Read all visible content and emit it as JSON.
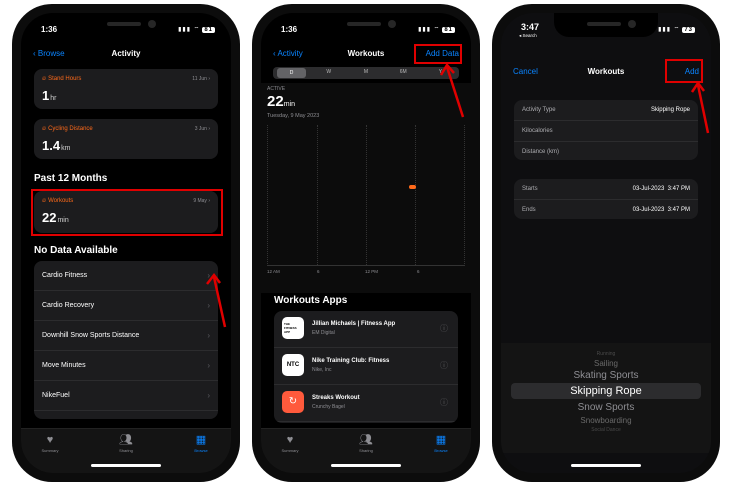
{
  "colors": {
    "accent": "#0a84ff",
    "activity": "#ff6a1a",
    "highlight": "#e00000"
  },
  "screen1": {
    "status_time": "1:36",
    "battery": "81",
    "nav": {
      "back": "Browse",
      "title": "Activity"
    },
    "cards": [
      {
        "label": "Stand Hours",
        "meta": "11 Jun",
        "value": "1",
        "unit": "hr"
      },
      {
        "label": "Cycling Distance",
        "meta": "3 Jun",
        "value": "1.4",
        "unit": "km"
      }
    ],
    "section_past": "Past 12 Months",
    "workouts_card": {
      "label": "Workouts",
      "meta": "9 May",
      "value": "22",
      "unit": "min"
    },
    "section_nodata": "No Data Available",
    "list": [
      "Cardio Fitness",
      "Cardio Recovery",
      "Downhill Snow Sports Distance",
      "Move Minutes",
      "NikeFuel"
    ],
    "tabs": [
      "Summary",
      "Sharing",
      "Browse"
    ]
  },
  "screen2": {
    "status_time": "1:36",
    "battery": "81",
    "nav": {
      "back": "Activity",
      "title": "Workouts",
      "right": "Add Data"
    },
    "segments": [
      "D",
      "W",
      "M",
      "6M",
      "Y"
    ],
    "active_label": "ACTIVE",
    "value": "22",
    "unit": "min",
    "date": "Tuesday, 9 May 2023",
    "chart_ticks": [
      "12 AM",
      "6",
      "12 PM",
      "6"
    ],
    "apps_title": "Workouts Apps",
    "apps": [
      {
        "name": "Jillian Michaels | Fitness App",
        "sub": "EM Digital",
        "icon_text": "THE FITNESS APP"
      },
      {
        "name": "Nike Training Club: Fitness",
        "sub": "Nike, Inc",
        "icon_text": "NTC"
      },
      {
        "name": "Streaks Workout",
        "sub": "Crunchy Bagel",
        "icon_text": ""
      }
    ],
    "tabs": [
      "Summary",
      "Sharing",
      "Browse"
    ]
  },
  "screen3": {
    "status_time": "3:47",
    "status_sub": "◂ Search",
    "battery": "73",
    "nav": {
      "left": "Cancel",
      "title": "Workouts",
      "right": "Add"
    },
    "fields": [
      {
        "key": "Activity Type",
        "value": "Skipping Rope"
      },
      {
        "key": "Kilocalories",
        "value": ""
      },
      {
        "key": "Distance (km)",
        "value": ""
      }
    ],
    "times": [
      {
        "key": "Starts",
        "date": "03-Jul-2023",
        "time": "3:47 PM"
      },
      {
        "key": "Ends",
        "date": "03-Jul-2023",
        "time": "3:47 PM"
      }
    ],
    "picker": [
      "Running",
      "Sailing",
      "Skating Sports",
      "Skipping Rope",
      "Snow Sports",
      "Snowboarding",
      "Social Dance"
    ]
  }
}
